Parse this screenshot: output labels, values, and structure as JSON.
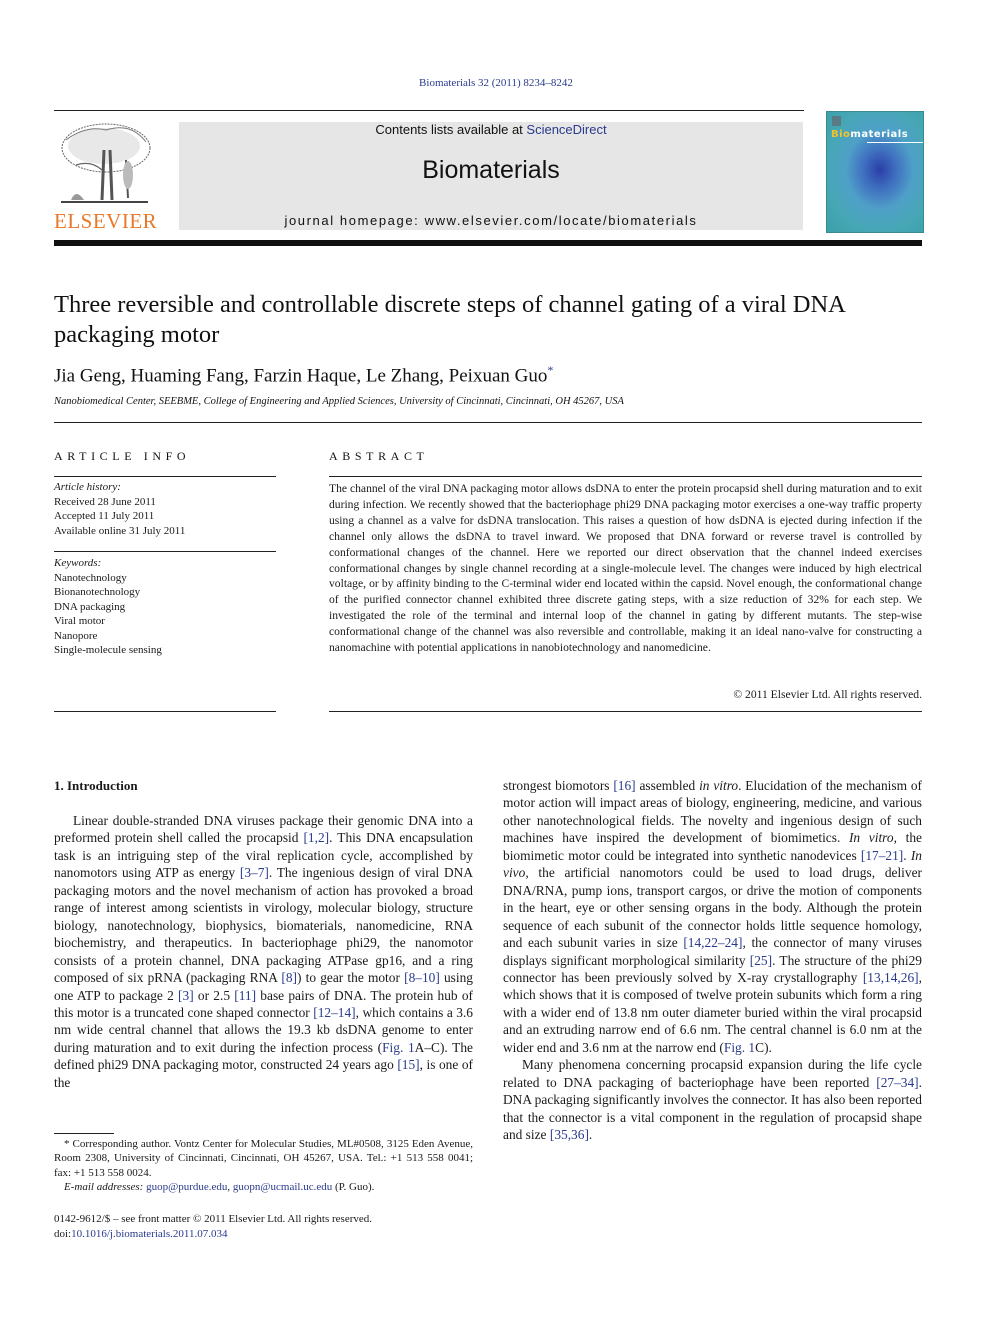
{
  "header": {
    "citation": "Biomaterials 32 (2011) 8234–8242",
    "contents_prefix": "Contents lists available at ",
    "contents_link": "ScienceDirect",
    "journal_name": "Biomaterials",
    "homepage": "journal homepage: www.elsevier.com/locate/biomaterials",
    "publisher_logo_text": "ELSEVIER",
    "cover_title_accent": "Bio",
    "cover_title_rest": "materials",
    "colors": {
      "link": "#2a3a8c",
      "elsevier_orange": "#e8782a",
      "masthead_bg": "#e6e6e6"
    }
  },
  "article": {
    "title": "Three reversible and controllable discrete steps of channel gating of a viral DNA packaging motor",
    "authors": "Jia Geng, Huaming Fang, Farzin Haque, Le Zhang, Peixuan Guo",
    "corresponding_mark": "*",
    "affiliation": "Nanobiomedical Center, SEEBME, College of Engineering and Applied Sciences, University of Cincinnati, Cincinnati, OH 45267, USA"
  },
  "article_info": {
    "heading": "ARTICLE INFO",
    "history_label": "Article history:",
    "history": [
      "Received 28 June 2011",
      "Accepted 11 July 2011",
      "Available online 31 July 2011"
    ],
    "keywords_label": "Keywords:",
    "keywords": [
      "Nanotechnology",
      "Bionanotechnology",
      "DNA packaging",
      "Viral motor",
      "Nanopore",
      "Single-molecule sensing"
    ]
  },
  "abstract": {
    "heading": "ABSTRACT",
    "text": "The channel of the viral DNA packaging motor allows dsDNA to enter the protein procapsid shell during maturation and to exit during infection. We recently showed that the bacteriophage phi29 DNA packaging motor exercises a one-way traffic property using a channel as a valve for dsDNA translocation. This raises a question of how dsDNA is ejected during infection if the channel only allows the dsDNA to travel inward. We proposed that DNA forward or reverse travel is controlled by conformational changes of the channel. Here we reported our direct observation that the channel indeed exercises conformational changes by single channel recording at a single-molecule level. The changes were induced by high electrical voltage, or by affinity binding to the C-terminal wider end located within the capsid. Novel enough, the conformational change of the purified connector channel exhibited three discrete gating steps, with a size reduction of 32% for each step. We investigated the role of the terminal and internal loop of the channel in gating by different mutants. The step-wise conformational change of the channel was also reversible and controllable, making it an ideal nano-valve for constructing a nanomachine with potential applications in nanobiotechnology and nanomedicine.",
    "copyright": "© 2011 Elsevier Ltd. All rights reserved."
  },
  "intro": {
    "heading": "1.  Introduction",
    "left": [
      {
        "t": "Linear double-stranded DNA viruses package their genomic DNA into a preformed protein shell called the procapsid "
      },
      {
        "r": "[1,2]"
      },
      {
        "t": ". This DNA encapsulation task is an intriguing step of the viral replication cycle, accomplished by nanomotors using ATP as energy "
      },
      {
        "r": "[3–7]"
      },
      {
        "t": ". The ingenious design of viral DNA packaging motors and the novel mechanism of action has provoked a broad range of interest among scientists in virology, molecular biology, structure biology, nanotechnology, biophysics, biomaterials, nanomedicine, RNA biochemistry, and therapeutics. In bacteriophage phi29, the nanomotor consists of a protein channel, DNA packaging ATPase gp16, and a ring composed of six pRNA (packaging RNA "
      },
      {
        "r": "[8]"
      },
      {
        "t": ") to gear the motor "
      },
      {
        "r": "[8–10]"
      },
      {
        "t": " using one ATP to package 2 "
      },
      {
        "r": "[3]"
      },
      {
        "t": " or 2.5 "
      },
      {
        "r": "[11]"
      },
      {
        "t": " base pairs of DNA. The protein hub of this motor is a truncated cone shaped connector "
      },
      {
        "r": "[12–14]"
      },
      {
        "t": ", which contains a 3.6 nm wide central channel that allows the 19.3 kb dsDNA genome to enter during maturation and to exit during the infection process ("
      },
      {
        "r": "Fig. 1"
      },
      {
        "t": "A–C). The defined phi29 DNA packaging motor, constructed 24 years ago "
      },
      {
        "r": "[15]"
      },
      {
        "t": ", is one of the"
      }
    ],
    "right_p1": [
      {
        "t": "strongest biomotors "
      },
      {
        "r": "[16]"
      },
      {
        "t": " assembled "
      },
      {
        "i": "in vitro"
      },
      {
        "t": ". Elucidation of the mechanism of motor action will impact areas of biology, engineering, medicine, and various other nanotechnological fields. The novelty and ingenious design of such machines have inspired the development of biomimetics. "
      },
      {
        "i": "In vitro"
      },
      {
        "t": ", the biomimetic motor could be integrated into synthetic nanodevices "
      },
      {
        "r": "[17–21]"
      },
      {
        "t": ". "
      },
      {
        "i": "In vivo"
      },
      {
        "t": ", the artificial nanomotors could be used to load drugs, deliver DNA/RNA, pump ions, transport cargos, or drive the motion of components in the heart, eye or other sensing organs in the body. Although the protein sequence of each subunit of the connector holds little sequence homology, and each subunit varies in size "
      },
      {
        "r": "[14,22–24]"
      },
      {
        "t": ", the connector of many viruses displays significant morphological similarity "
      },
      {
        "r": "[25]"
      },
      {
        "t": ". The structure of the phi29 connector has been previously solved by X-ray crystallography "
      },
      {
        "r": "[13,14,26]"
      },
      {
        "t": ", which shows that it is composed of twelve protein subunits which form a ring with a wider end of 13.8 nm outer diameter buried within the viral procapsid and an extruding narrow end of 6.6 nm. The central channel is 6.0 nm at the wider end and 3.6 nm at the narrow end ("
      },
      {
        "r": "Fig. 1"
      },
      {
        "t": "C)."
      }
    ],
    "right_p2": [
      {
        "t": "Many phenomena concerning procapsid expansion during the life cycle related to DNA packaging of bacteriophage have been reported "
      },
      {
        "r": "[27–34]"
      },
      {
        "t": ". DNA packaging significantly involves the connector. It has also been reported that the connector is a vital component in the regulation of procapsid shape and size "
      },
      {
        "r": "[35,36]"
      },
      {
        "t": "."
      }
    ]
  },
  "footnote": {
    "corresponding": "* Corresponding author. Vontz Center for Molecular Studies, ML#0508, 3125 Eden Avenue, Room 2308, University of Cincinnati, Cincinnati, OH 45267, USA. Tel.: +1 513 558 0041; fax: +1 513 558 0024.",
    "email_label": "E-mail addresses:",
    "email1": "guop@purdue.edu",
    "email2": "guopn@ucmail.uc.edu",
    "email_suffix": " (P. Guo).",
    "front_matter": "0142-9612/$ – see front matter © 2011 Elsevier Ltd. All rights reserved.",
    "doi_prefix": "doi:",
    "doi": "10.1016/j.biomaterials.2011.07.034"
  }
}
